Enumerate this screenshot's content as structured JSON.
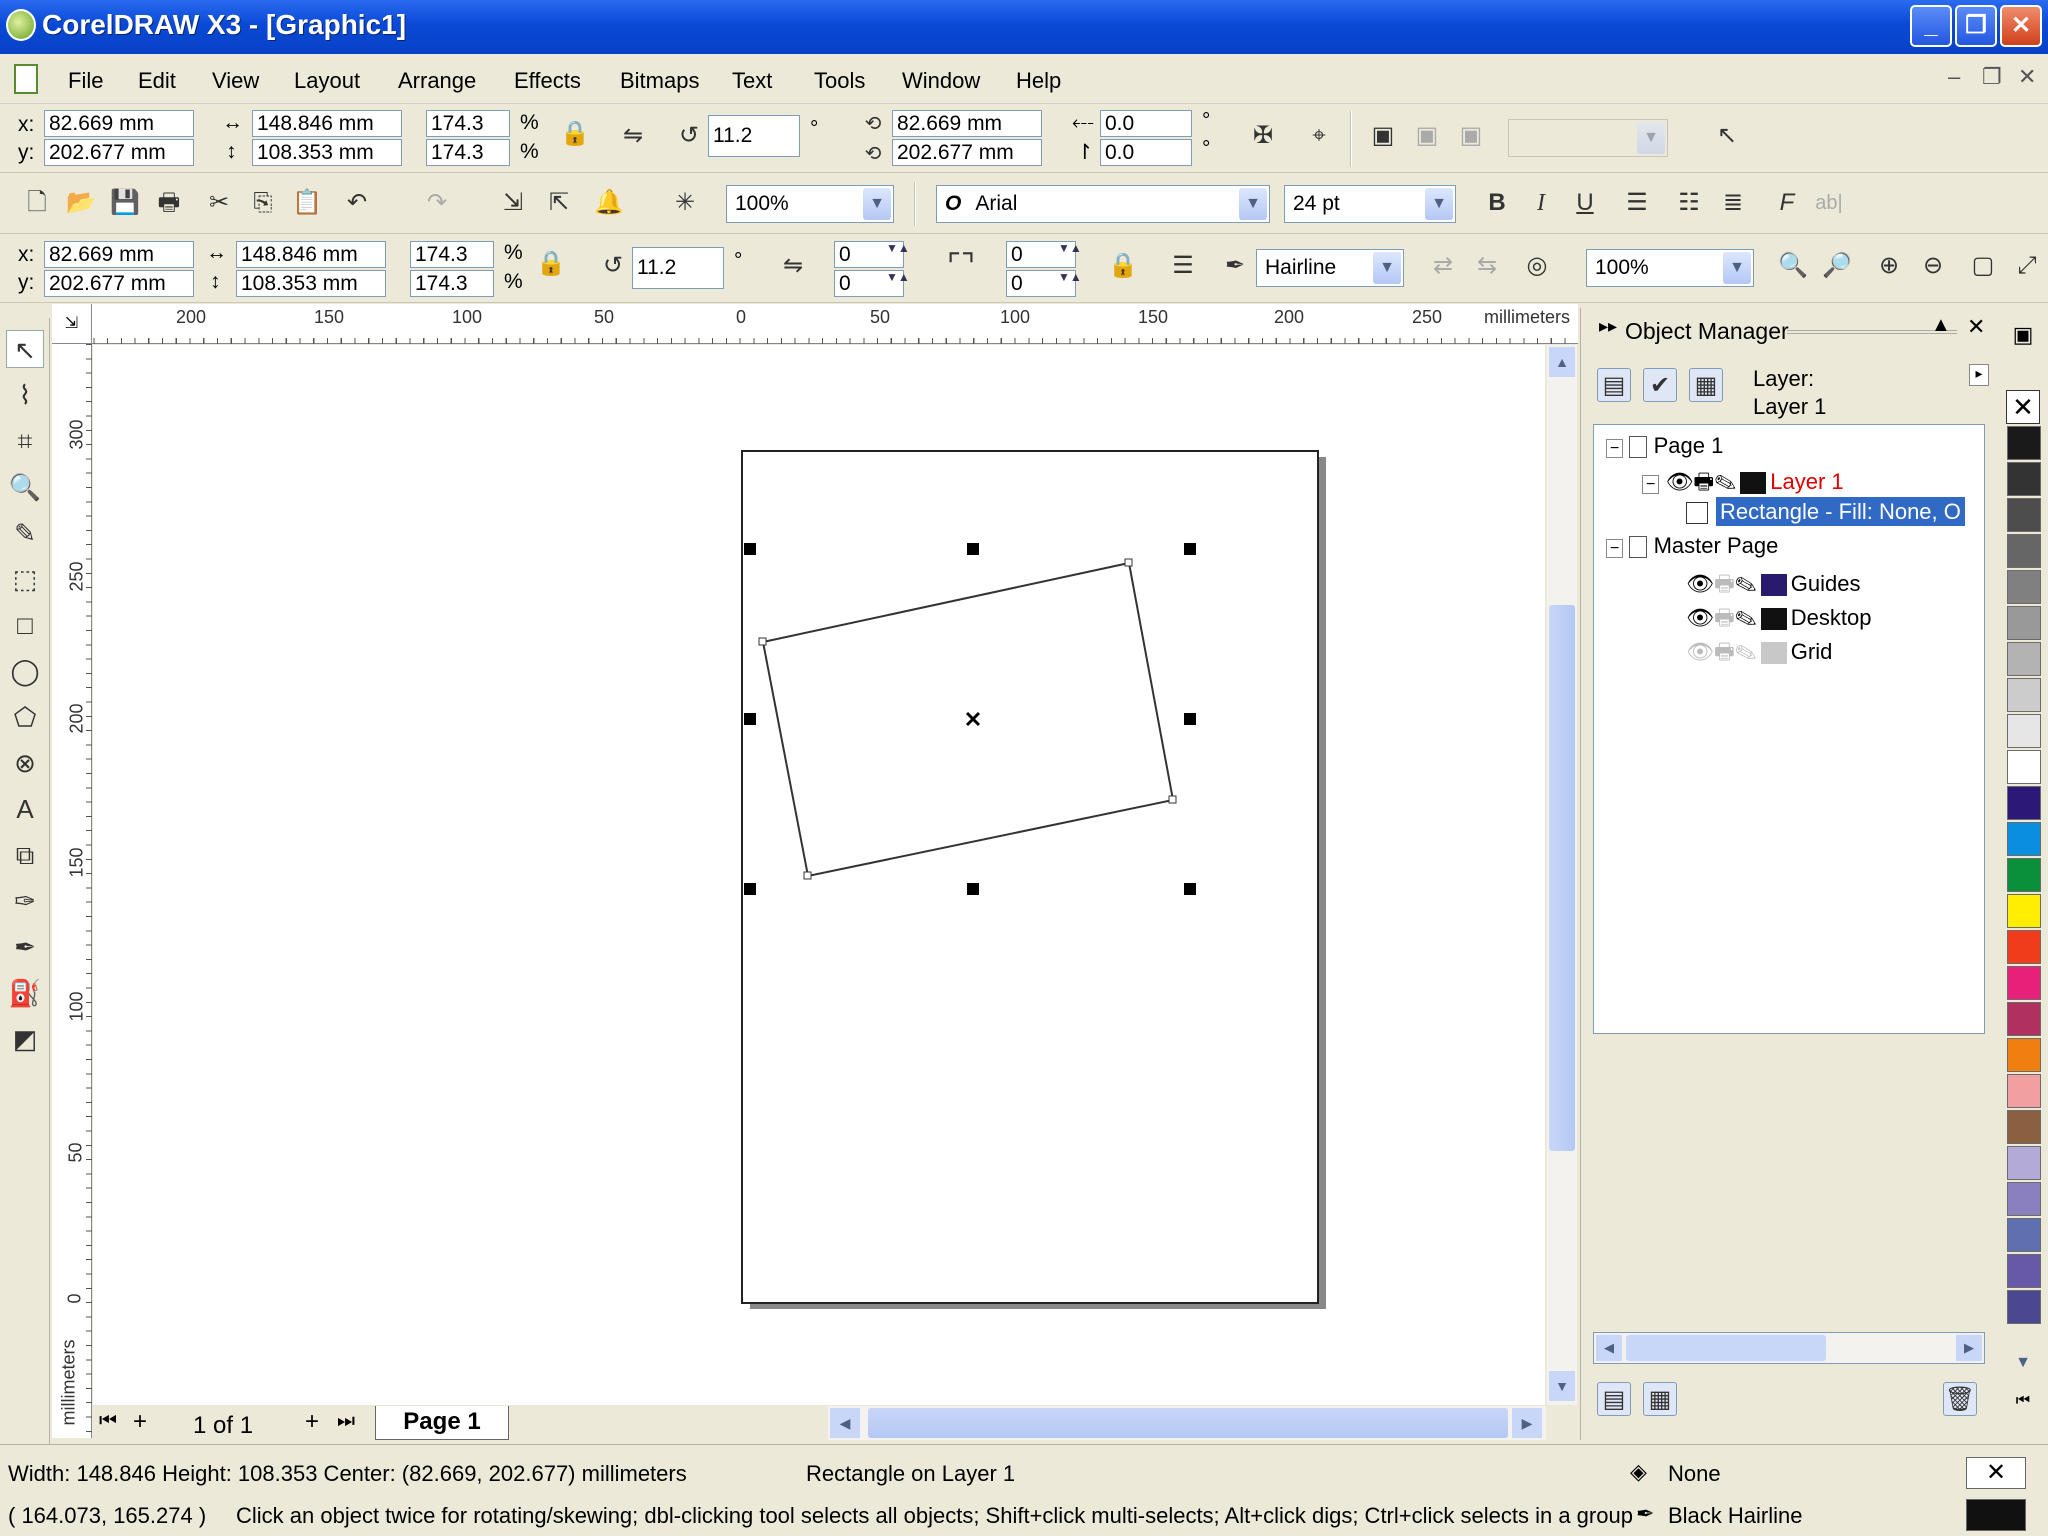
{
  "title": "CorelDRAW X3 - [Graphic1]",
  "window_buttons": {
    "minimize": "_",
    "restore": "❐",
    "close": "✕"
  },
  "menus": [
    "File",
    "Edit",
    "View",
    "Layout",
    "Arrange",
    "Effects",
    "Bitmaps",
    "Text",
    "Tools",
    "Window",
    "Help"
  ],
  "mdi_buttons": {
    "minimize": "–",
    "restore": "❐",
    "close": "✕"
  },
  "property_bar_1": {
    "x_label": "x:",
    "x_value": "82.669 mm",
    "y_label": "y:",
    "y_value": "202.677 mm",
    "width_value": "148.846 mm",
    "height_value": "108.353 mm",
    "scale_x": "174.3",
    "scale_y": "174.3",
    "pct": "%",
    "angle": "11.2",
    "deg": "°",
    "center_x": "82.669 mm",
    "center_y": "202.677 mm",
    "skew_h": "0.0",
    "skew_v": "0.0"
  },
  "standard_bar": {
    "zoom": "100%",
    "font": "Arial",
    "font_size": "24 pt",
    "bold": "B",
    "italic": "I",
    "underline": "U"
  },
  "property_bar_2": {
    "x_label": "x:",
    "x_value": "82.669 mm",
    "y_label": "y:",
    "y_value": "202.677 mm",
    "width_value": "148.846 mm",
    "height_value": "108.353 mm",
    "scale_x": "174.3",
    "scale_y": "174.3",
    "pct": "%",
    "angle": "11.2",
    "deg": "°",
    "corner_a": "0",
    "corner_b": "0",
    "corner_c": "0",
    "corner_d": "0",
    "outline_width": "Hairline",
    "zoom": "100%"
  },
  "ruler_h": {
    "ticks": [
      "200",
      "150",
      "100",
      "50",
      "0",
      "50",
      "100",
      "150",
      "200",
      "250"
    ],
    "unit": "millimeters"
  },
  "ruler_v": {
    "ticks": [
      "300",
      "250",
      "200",
      "150",
      "100",
      "50",
      "0"
    ],
    "unit": "millimeters"
  },
  "page_nav": {
    "counter": "1 of 1",
    "tab": "Page 1",
    "add": "+"
  },
  "object_manager": {
    "title": "Object Manager",
    "layer_caption": "Layer:",
    "layer_name": "Layer 1",
    "tree": {
      "page": "Page 1",
      "layer": "Layer 1",
      "object": "Rectangle - Fill: None, O",
      "master": "Master Page",
      "guides": "Guides",
      "desktop": "Desktop",
      "grid": "Grid"
    },
    "colors": {
      "layer": "#111111",
      "guides": "#2a1a6e",
      "desktop": "#111111",
      "grid": "#c8c8c8",
      "active_layer_text": "#e00000",
      "selection": "#316ac5"
    }
  },
  "palette": [
    "#1a1a1a",
    "#333333",
    "#4d4d4d",
    "#666666",
    "#808080",
    "#999999",
    "#b3b3b3",
    "#cccccc",
    "#e6e6e6",
    "#ffffff",
    "#2b1877",
    "#0a8fe0",
    "#0a8f3a",
    "#ffee00",
    "#f03c1a",
    "#e8207a",
    "#b03060",
    "#f07e10",
    "#f0a0a0",
    "#8a6040",
    "#b4aad8",
    "#8a80c0",
    "#5e70b0",
    "#6858a8",
    "#4a4890"
  ],
  "status": {
    "dimensions": "Width: 148.846  Height: 108.353  Center: (82.669, 202.677)  millimeters",
    "object_info": "Rectangle on Layer 1",
    "coords": "( 164.073, 165.274 )",
    "hint": "Click an object twice for rotating/skewing; dbl-clicking tool selects all objects; Shift+click multi-selects; Alt+click digs; Ctrl+click selects in a group",
    "fill": "None",
    "outline": "Black  Hairline"
  }
}
